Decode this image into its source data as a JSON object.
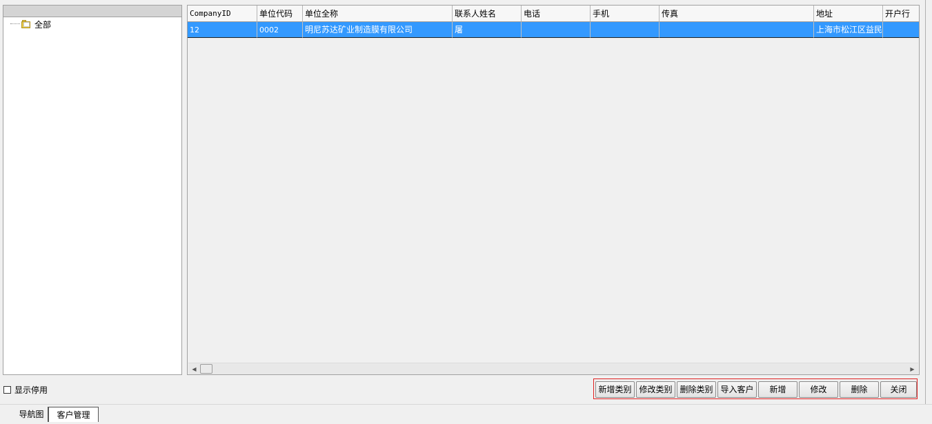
{
  "tree": {
    "root_label": "全部"
  },
  "grid": {
    "columns": [
      "CompanyID",
      "单位代码",
      "单位全称",
      "联系人姓名",
      "电话",
      "手机",
      "传真",
      "地址",
      "开户行"
    ],
    "rows": [
      [
        "12",
        "0002",
        "明尼苏达矿业制造膜有限公司",
        "屠",
        "",
        "",
        "",
        "上海市松江区益民",
        ""
      ]
    ],
    "selected_row_color": "#3399ff"
  },
  "scrollbar": {
    "left_arrow": "◀",
    "right_arrow": "▶"
  },
  "show_disabled": {
    "label": "显示停用",
    "checked": false
  },
  "buttons": {
    "add_category": "新增类别",
    "edit_category": "修改类别",
    "delete_category": "删除类别",
    "import_customer": "导入客户",
    "add": "新增",
    "edit": "修改",
    "delete": "删除",
    "close": "关闭"
  },
  "tabs": {
    "nav": "导航图",
    "customer": "客户管理"
  }
}
